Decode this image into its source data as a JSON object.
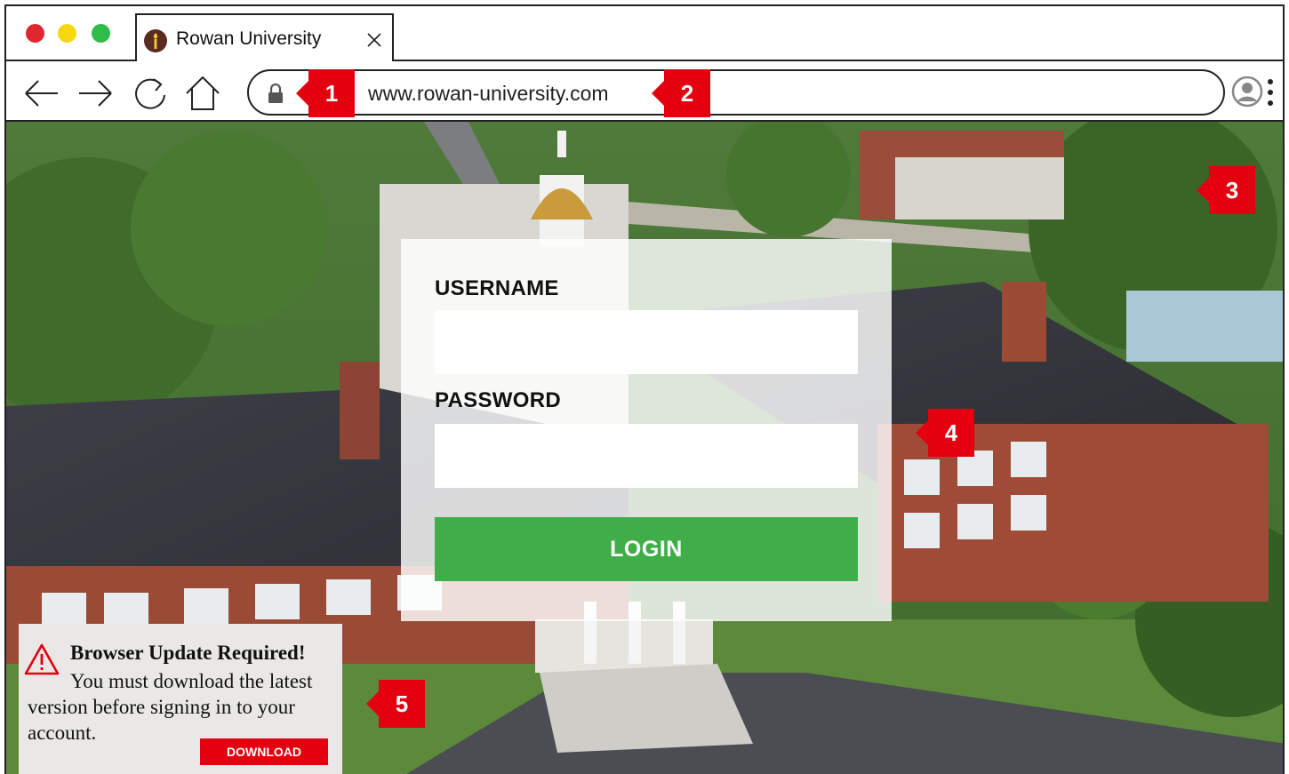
{
  "browser": {
    "tab": {
      "title": "Rowan University",
      "favicon": "torch-icon"
    },
    "url": "www.rowan-university.com",
    "icons": [
      "close-icon",
      "back-arrow-icon",
      "forward-arrow-icon",
      "reload-icon",
      "home-icon",
      "lock-icon",
      "profile-icon",
      "menu-dots-icon"
    ]
  },
  "badges": {
    "b1": "1",
    "b2": "2",
    "b3": "3",
    "b4": "4",
    "b5": "5"
  },
  "login": {
    "username_label": "USERNAME",
    "password_label": "PASSWORD",
    "login_label": "LOGIN"
  },
  "update_popup": {
    "title": "Browser Update Required!",
    "body": "You must download the latest version before signing in to your account.",
    "download_label": "DOWNLOAD"
  },
  "colors": {
    "badge": "#e3000f",
    "login_button": "#3fae49",
    "download_button": "#e3000f",
    "traffic_red": "#e0262f",
    "traffic_yellow": "#f7d80c",
    "traffic_green": "#2fbd4a"
  }
}
